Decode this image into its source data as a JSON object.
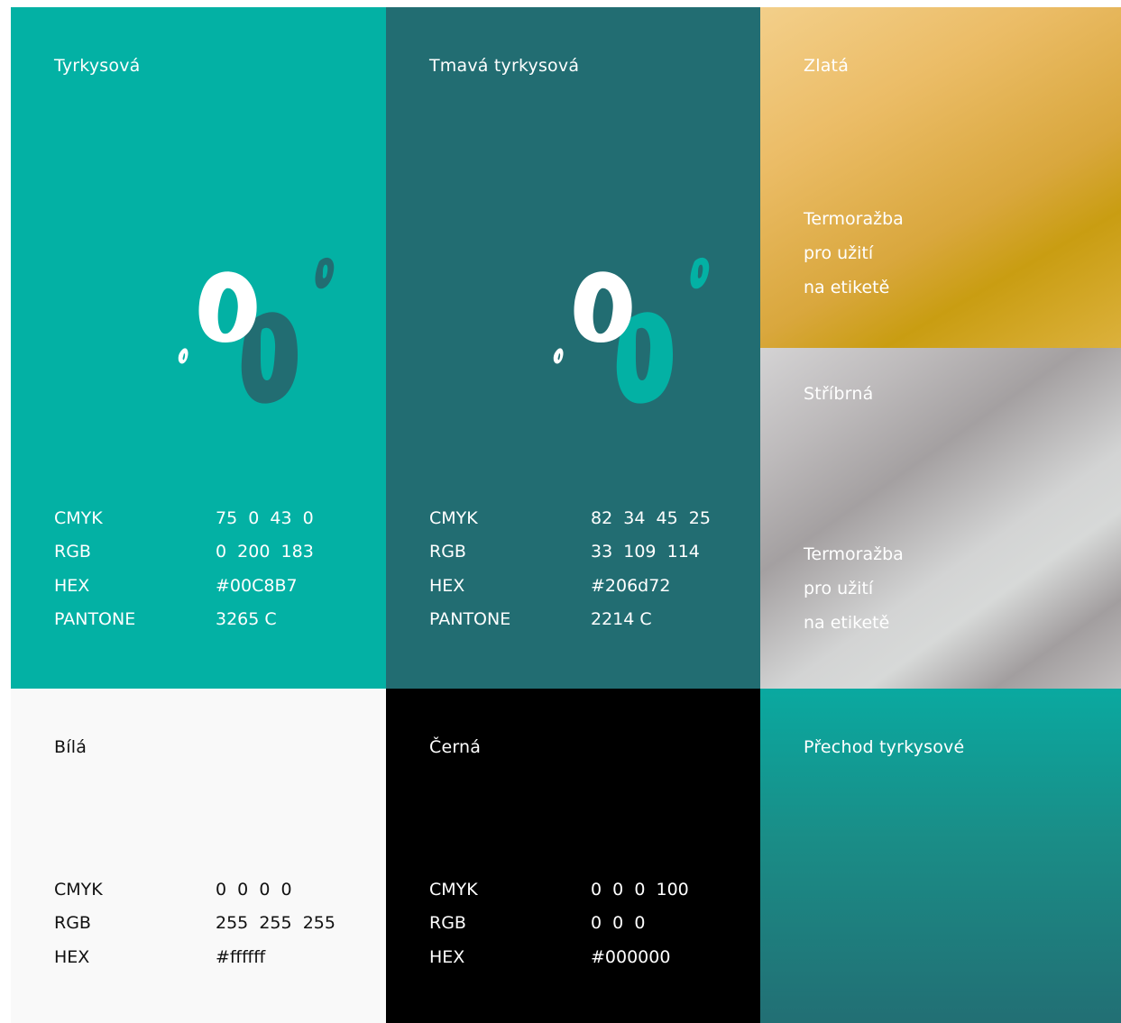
{
  "colors": {
    "turquoise": "#03b1a4",
    "dark_turquoise": "#226d72",
    "white": "#f9f9f9",
    "black": "#000000",
    "logo_white": "#ffffff"
  },
  "swatches": {
    "turquoise": {
      "name": "Tyrkysová",
      "specs": [
        {
          "key": "CMYK",
          "value": "75  0  43  0"
        },
        {
          "key": "RGB",
          "value": "0  200  183"
        },
        {
          "key": "HEX",
          "value": "#00C8B7"
        },
        {
          "key": "PANTONE",
          "value": "3265 C"
        }
      ]
    },
    "dark_turquoise": {
      "name": "Tmavá tyrkysová",
      "specs": [
        {
          "key": "CMYK",
          "value": "82  34  45  25"
        },
        {
          "key": "RGB",
          "value": "33  109  114"
        },
        {
          "key": "HEX",
          "value": "#206d72"
        },
        {
          "key": "PANTONE",
          "value": "2214 C"
        }
      ]
    },
    "gold": {
      "name": "Zlatá",
      "note": [
        "Termoražba",
        "pro užití",
        "na etiketě"
      ]
    },
    "silver": {
      "name": "Stříbrná",
      "note": [
        "Termoražba",
        "pro užití",
        "na etiketě"
      ]
    },
    "white": {
      "name": "Bílá",
      "specs": [
        {
          "key": "CMYK",
          "value": "0  0  0  0"
        },
        {
          "key": "RGB",
          "value": "255  255  255"
        },
        {
          "key": "HEX",
          "value": "#ffffff"
        }
      ]
    },
    "black": {
      "name": "Černá",
      "specs": [
        {
          "key": "CMYK",
          "value": "0  0  0  100"
        },
        {
          "key": "RGB",
          "value": "0  0  0"
        },
        {
          "key": "HEX",
          "value": "#000000"
        }
      ]
    },
    "gradient": {
      "name": "Přechod tyrkysové"
    }
  },
  "logo_icon": "bubbles-logo-icon"
}
